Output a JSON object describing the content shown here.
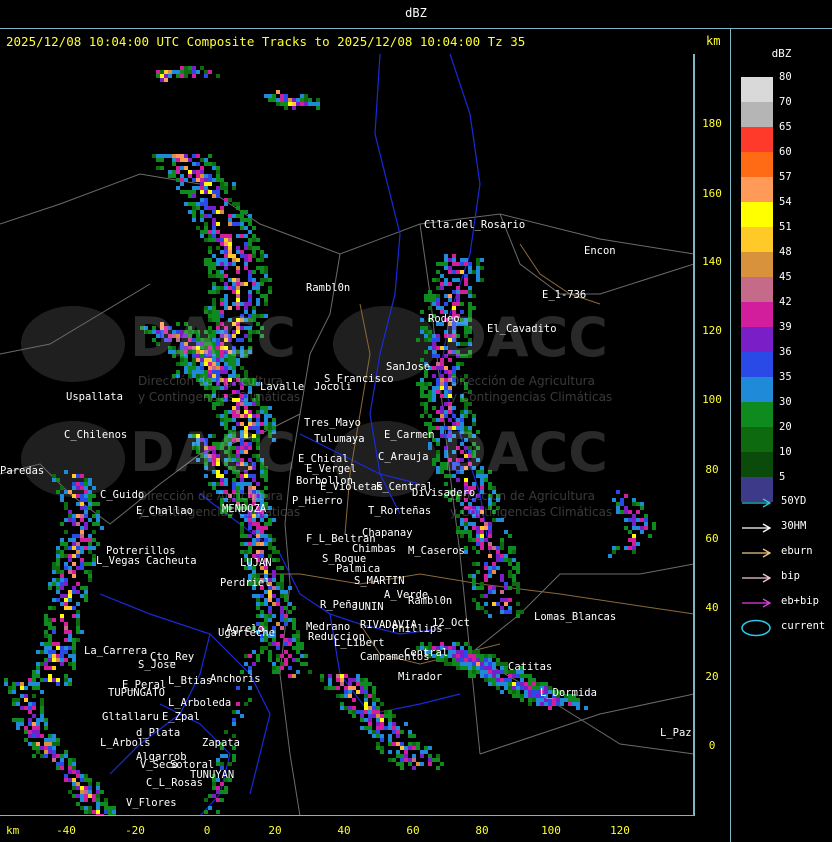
{
  "top_title": "dBZ",
  "header": {
    "text": "2025/12/08 10:04:00 UTC Composite Tracks to 2025/12/08 10:04:00 Tz 35",
    "km_label": "km"
  },
  "axes": {
    "y_ticks": [
      "180",
      "160",
      "140",
      "120",
      "100",
      "80",
      "60",
      "40",
      "20",
      "0"
    ],
    "x_ticks": [
      "-40",
      "-20",
      "0",
      "20",
      "40",
      "60",
      "80",
      "100",
      "120"
    ],
    "km_label": "km"
  },
  "legend": {
    "title": "dBZ",
    "scale": [
      {
        "label": "80",
        "color": "#d9d9d9"
      },
      {
        "label": "70",
        "color": "#b5b5b5"
      },
      {
        "label": "65",
        "color": "#ff3a2a"
      },
      {
        "label": "60",
        "color": "#ff6a14"
      },
      {
        "label": "57",
        "color": "#ff9a58"
      },
      {
        "label": "54",
        "color": "#ffff00"
      },
      {
        "label": "51",
        "color": "#ffc928"
      },
      {
        "label": "48",
        "color": "#d9923c"
      },
      {
        "label": "45",
        "color": "#c66a8a"
      },
      {
        "label": "42",
        "color": "#d21e9c"
      },
      {
        "label": "39",
        "color": "#7a1ec8"
      },
      {
        "label": "36",
        "color": "#2a4ae8"
      },
      {
        "label": "35",
        "color": "#1e8ad8"
      },
      {
        "label": "30",
        "color": "#0e8a1e"
      },
      {
        "label": "20",
        "color": "#0e6a0e"
      },
      {
        "label": "10",
        "color": "#0a4a0a"
      },
      {
        "label": "5",
        "color": "#3e3a8a"
      }
    ],
    "tracks": [
      {
        "label": "50YD",
        "color": "#2ec8d8"
      },
      {
        "label": "30HM",
        "color": "#ffffff"
      },
      {
        "label": "eburn",
        "color": "#f0c880"
      },
      {
        "label": "bip",
        "color": "#f0c8d8"
      },
      {
        "label": "eb+bip",
        "color": "#e040e0"
      }
    ],
    "current_label": "current",
    "current_color": "#2ec8e8"
  },
  "places": [
    {
      "name": "Clla.del_Rosario"
    },
    {
      "name": "Encon"
    },
    {
      "name": "E_1-736"
    },
    {
      "name": "Rodeo"
    },
    {
      "name": "El_Cavadito"
    },
    {
      "name": "Uspallata"
    },
    {
      "name": "S_Francisco"
    },
    {
      "name": "SanJose"
    },
    {
      "name": "C_Chilenos"
    },
    {
      "name": "Tres_Mayo"
    },
    {
      "name": "Tulumaya"
    },
    {
      "name": "E_Carmen"
    },
    {
      "name": "E_Chical"
    },
    {
      "name": "E_Vergel"
    },
    {
      "name": "C_Arauja"
    },
    {
      "name": "Borbollon"
    },
    {
      "name": "E_Violetas"
    },
    {
      "name": "P_Hierro"
    },
    {
      "name": "E_Central"
    },
    {
      "name": "C_Guido"
    },
    {
      "name": "E_Challao"
    },
    {
      "name": "T_Rorteñas"
    },
    {
      "name": "F_L_Beltran"
    },
    {
      "name": "Chapanay"
    },
    {
      "name": "Potrerillos"
    },
    {
      "name": "L_Vegas"
    },
    {
      "name": "Chimbas"
    },
    {
      "name": "M_Caseros"
    },
    {
      "name": "S_Roque"
    },
    {
      "name": "Palmica"
    },
    {
      "name": "S_MARTIN"
    },
    {
      "name": "Perdriel"
    },
    {
      "name": "A_Verde"
    },
    {
      "name": "Rambl0n"
    },
    {
      "name": "Agrelo"
    },
    {
      "name": "R_Peña"
    },
    {
      "name": "JUNIN"
    },
    {
      "name": "Lomas_Blancas"
    },
    {
      "name": "Ugarteche"
    },
    {
      "name": "Medrano"
    },
    {
      "name": "RIVADAVIA"
    },
    {
      "name": "Phillips"
    },
    {
      "name": "12_Oct"
    },
    {
      "name": "Reduccion"
    },
    {
      "name": "L_Libert"
    },
    {
      "name": "La_Carrera"
    },
    {
      "name": "Cto_Rey"
    },
    {
      "name": "S_Jose"
    },
    {
      "name": "Campamentos"
    },
    {
      "name": "Central"
    },
    {
      "name": "Catitas"
    },
    {
      "name": "E_Peral"
    },
    {
      "name": "L_Btias"
    },
    {
      "name": "Anchoris"
    },
    {
      "name": "TUPUNGATO"
    },
    {
      "name": "Mirador"
    },
    {
      "name": "L_Dormida"
    },
    {
      "name": "L_Arboleda"
    },
    {
      "name": "Gltallaru"
    },
    {
      "name": "E_Zpal"
    },
    {
      "name": "d_Plata"
    },
    {
      "name": "L_Arbols"
    },
    {
      "name": "Zapata"
    },
    {
      "name": "Algarrob"
    },
    {
      "name": "V_Seco"
    },
    {
      "name": "Sotoral"
    },
    {
      "name": "TUNUYAN"
    },
    {
      "name": "C_L_Rosas"
    },
    {
      "name": "V_Flores"
    },
    {
      "name": "Rambl0n"
    },
    {
      "name": "Jocoli"
    },
    {
      "name": "Lavalle"
    },
    {
      "name": "L_Paz"
    },
    {
      "name": "Divisadero"
    },
    {
      "name": "MENDOZA"
    },
    {
      "name": "Paredas"
    },
    {
      "name": "LUJAN"
    },
    {
      "name": "Cacheuta"
    }
  ],
  "watermark": {
    "text": "DACC",
    "subtitle1": "Dirección de Agricultura",
    "subtitle2": "y Contingencias Climáticas"
  }
}
